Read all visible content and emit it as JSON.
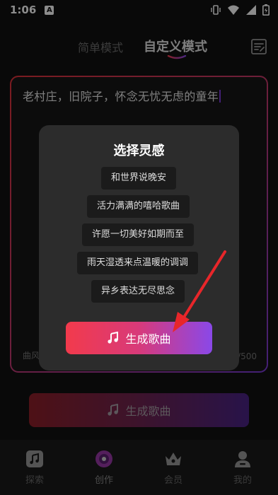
{
  "status_bar": {
    "time": "1:06",
    "notification_letter": "A"
  },
  "header": {
    "tabs": [
      {
        "label": "简单模式",
        "active": false
      },
      {
        "label": "自定义模式",
        "active": true
      }
    ],
    "edit_icon": "edit-list-icon"
  },
  "prompt": {
    "text": "老村庄，旧院子，怀念无忧无虑的童年",
    "style_label": "曲风",
    "counter": "/500"
  },
  "modal": {
    "title": "选择灵感",
    "options": [
      "和世界说晚安",
      "活力满满的嘻哈歌曲",
      "许愿一切美好如期而至",
      "雨天湿透来点温暖的调调",
      "异乡表达无尽思念"
    ],
    "generate_label": "生成歌曲",
    "generate_icon": "music-note-icon"
  },
  "bottom_button": {
    "label": "生成歌曲",
    "icon": "music-note-icon"
  },
  "bottom_nav": {
    "items": [
      {
        "label": "探索",
        "icon": "music-square-icon",
        "active": false
      },
      {
        "label": "创作",
        "icon": "vinyl-disc-icon",
        "active": true
      },
      {
        "label": "会员",
        "icon": "crown-icon",
        "active": false
      },
      {
        "label": "我的",
        "icon": "user-icon",
        "active": false
      }
    ]
  },
  "colors": {
    "background": "#111111",
    "gradient_start": "#f23a4c",
    "gradient_end": "#8a48e8",
    "arrow": "#e8262a",
    "modal_bg": "#2c2c2c"
  }
}
